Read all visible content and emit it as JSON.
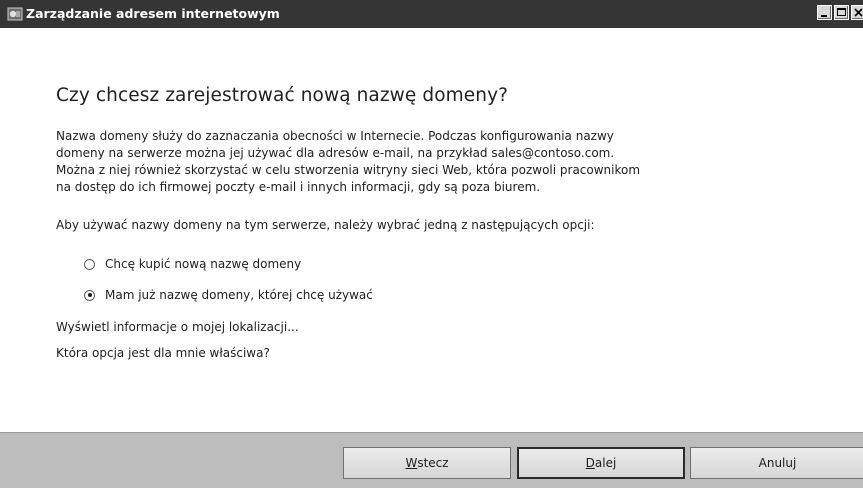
{
  "window": {
    "title": "Zarządzanie adresem internetowym",
    "icon": "app-window-icon",
    "controls": [
      "minimize-icon",
      "maximize-icon",
      "close-icon"
    ]
  },
  "content": {
    "heading": "Czy chcesz zarejestrować nową nazwę domeny?",
    "description_lines": [
      "Nazwa domeny służy do zaznaczania obecności w Internecie. Podczas konfigurowania nazwy",
      "domeny na serwerze można jej używać dla adresów e-mail, na przykład sales@contoso.com.",
      "Można z niej również skorzystać w celu stworzenia witryny sieci Web, która pozwoli pracownikom",
      "na dostęp do ich firmowej poczty e-mail i innych informacji, gdy są poza biurem."
    ],
    "instruction": "Aby używać nazwy domeny na tym serwerze, należy wybrać jedną z następujących opcji:",
    "options": [
      {
        "label": "Chcę kupić nową nazwę domeny",
        "selected": false
      },
      {
        "label": "Mam już nazwę domeny, której chcę używać",
        "selected": true
      }
    ],
    "links": {
      "location_info": "Wyświetl informacje o mojej lokalizacji...",
      "which_option": "Która opcja jest dla mnie właściwa?"
    }
  },
  "footer": {
    "back": {
      "mnemonic": "W",
      "rest": "stecz"
    },
    "next": {
      "mnemonic": "D",
      "rest": "alej"
    },
    "cancel": "Anuluj"
  },
  "colors": {
    "titlebar": "#353535",
    "footer": "#bdbdbd",
    "text": "#1e1e1e"
  }
}
